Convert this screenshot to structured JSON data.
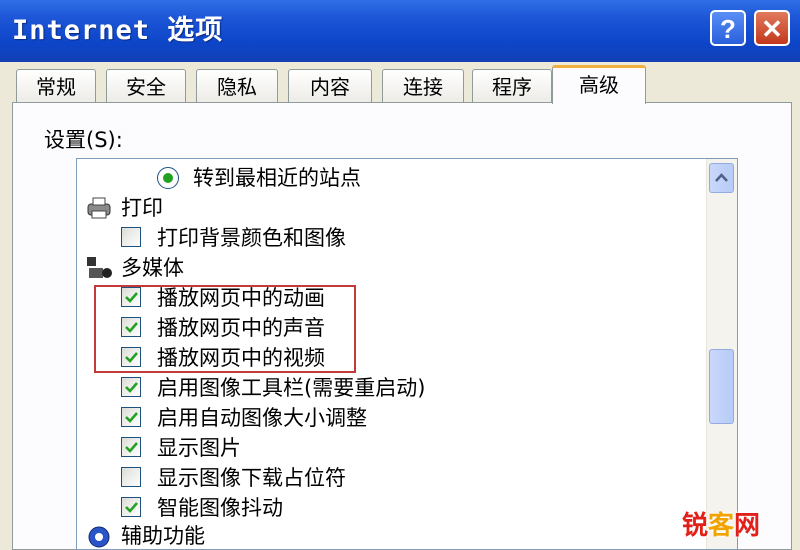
{
  "window": {
    "title": "Internet 选项",
    "help_label": "?",
    "close_label": "✕"
  },
  "tabs": [
    "常规",
    "安全",
    "隐私",
    "内容",
    "连接",
    "程序",
    "高级"
  ],
  "active_tab": "高级",
  "settings_label": "设置(S):",
  "settings": {
    "rows": [
      {
        "type": "radio",
        "label": "转到最相近的站点",
        "checked": true
      },
      {
        "type": "category",
        "label": "打印",
        "icon": "printer-icon"
      },
      {
        "type": "checkbox",
        "label": "打印背景颜色和图像",
        "checked": false
      },
      {
        "type": "category",
        "label": "多媒体",
        "icon": "multimedia-icon"
      },
      {
        "type": "checkbox",
        "label": "播放网页中的动画",
        "checked": true
      },
      {
        "type": "checkbox",
        "label": "播放网页中的声音",
        "checked": true
      },
      {
        "type": "checkbox",
        "label": "播放网页中的视频",
        "checked": true
      },
      {
        "type": "checkbox",
        "label": "启用图像工具栏(需要重启动)",
        "checked": true
      },
      {
        "type": "checkbox",
        "label": "启用自动图像大小调整",
        "checked": true
      },
      {
        "type": "checkbox",
        "label": "显示图片",
        "checked": true
      },
      {
        "type": "checkbox",
        "label": "显示图像下载占位符",
        "checked": false
      },
      {
        "type": "checkbox",
        "label": "智能图像抖动",
        "checked": true
      },
      {
        "type": "category",
        "label": "辅助功能",
        "icon": "accessibility-icon"
      }
    ]
  },
  "watermark": {
    "part1": "锐",
    "part2": "客",
    "part3": "网"
  },
  "colors": {
    "title_bar": "#0d45c8",
    "highlight_border": "#c23a3a",
    "check_green": "#21a121"
  }
}
